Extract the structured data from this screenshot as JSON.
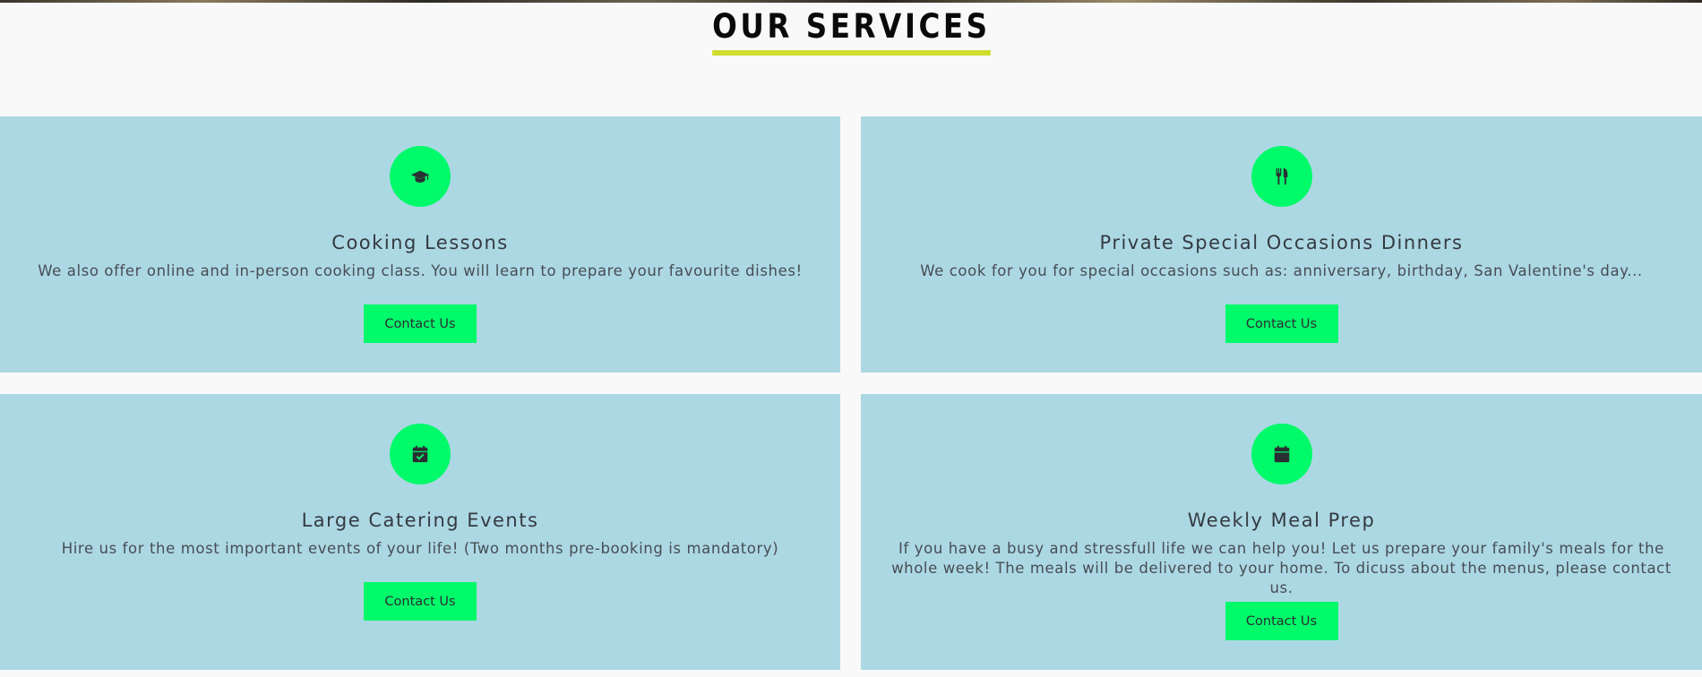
{
  "section": {
    "title": "OUR SERVICES"
  },
  "colors": {
    "background": "#f9f9f9",
    "card_background": "#acd8e4",
    "accent_green": "#00fa6a",
    "title_underline": "#cfdd2c",
    "text": "#343a40"
  },
  "services": [
    {
      "icon": "graduation-cap-icon",
      "title": "Cooking Lessons",
      "description": "We also offer online and in-person cooking class. You will learn to prepare your favourite dishes!",
      "button_label": "Contact Us"
    },
    {
      "icon": "utensils-icon",
      "title": "Private Special Occasions Dinners",
      "description": "We cook for you for special occasions such as: anniversary, birthday, San Valentine's day...",
      "button_label": "Contact Us"
    },
    {
      "icon": "calendar-check-icon",
      "title": "Large Catering Events",
      "description": "Hire us for the most important events of your life! (Two months pre-booking is mandatory)",
      "button_label": "Contact Us"
    },
    {
      "icon": "calendar-icon",
      "title": "Weekly Meal Prep",
      "description": "If you have a busy and stressfull life we can help you! Let us prepare your family's meals for the whole week! The meals will be delivered to your home. To dicuss about the menus, please contact us.",
      "button_label": "Contact Us"
    }
  ]
}
